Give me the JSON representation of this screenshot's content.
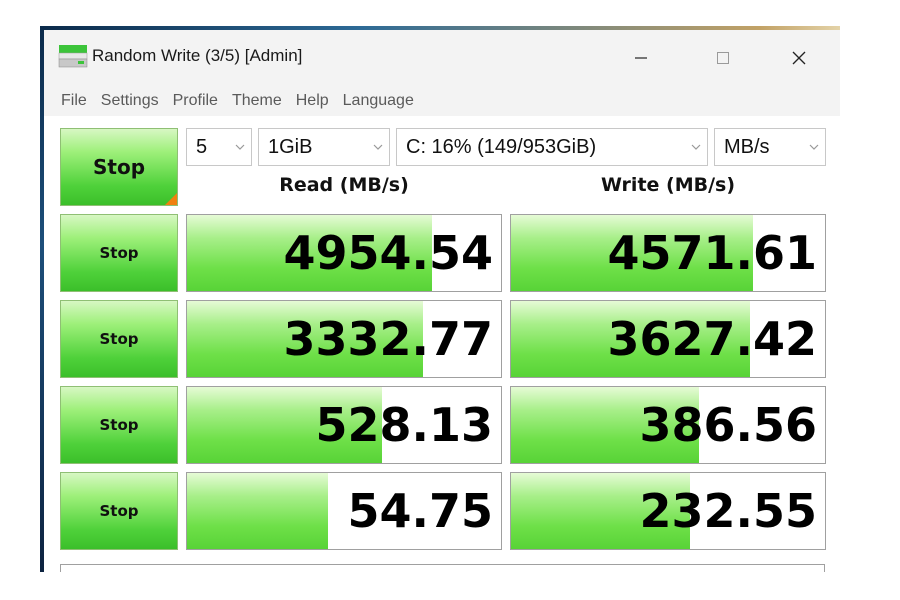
{
  "window": {
    "title": "Random Write (3/5) [Admin]"
  },
  "menu": [
    "File",
    "Settings",
    "Profile",
    "Theme",
    "Help",
    "Language"
  ],
  "controls": {
    "all_button_label": "Stop",
    "count": "5",
    "size": "1GiB",
    "drive": "C: 16% (149/953GiB)",
    "unit": "MB/s"
  },
  "headers": {
    "read": "Read (MB/s)",
    "write": "Write (MB/s)"
  },
  "rows": [
    {
      "button_label": "Stop",
      "read": "4954.54",
      "write": "4571.61",
      "read_fill": 0.78,
      "write_fill": 0.77
    },
    {
      "button_label": "Stop",
      "read": "3332.77",
      "write": "3627.42",
      "read_fill": 0.75,
      "write_fill": 0.76
    },
    {
      "button_label": "Stop",
      "read": "528.13",
      "write": "386.56",
      "read_fill": 0.62,
      "write_fill": 0.6
    },
    {
      "button_label": "Stop",
      "read": "54.75",
      "write": "232.55",
      "read_fill": 0.45,
      "write_fill": 0.57
    }
  ],
  "colors": {
    "accent_green": "#4fd13a",
    "corner_orange": "#f08010"
  }
}
